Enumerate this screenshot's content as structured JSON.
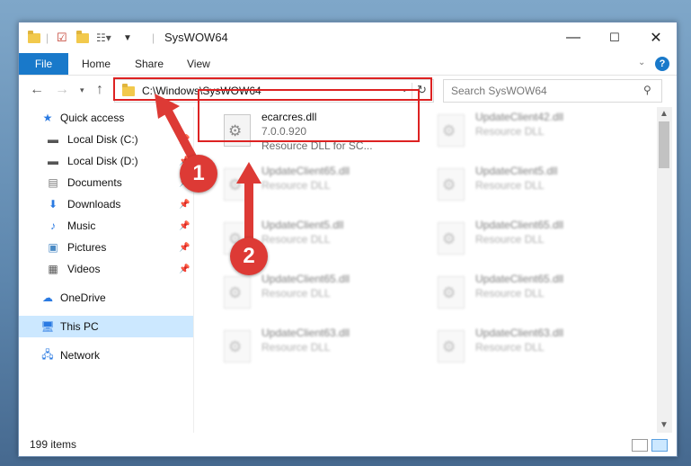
{
  "window": {
    "title": "SysWOW64",
    "controls": {
      "minimize": "—",
      "maximize": "☐",
      "close": "✕"
    }
  },
  "ribbon": {
    "file_tab": "File",
    "tabs": [
      "Home",
      "Share",
      "View"
    ],
    "help": "?"
  },
  "address_bar": {
    "path": "C:\\Windows\\SysWOW64"
  },
  "search": {
    "placeholder": "Search SysWOW64"
  },
  "sidebar": {
    "items": [
      {
        "label": "Quick access",
        "icon": "star-icon"
      },
      {
        "label": "Local Disk (C:)",
        "icon": "drive-icon",
        "pinned": true
      },
      {
        "label": "Local Disk (D:)",
        "icon": "drive-icon",
        "pinned": true
      },
      {
        "label": "Documents",
        "icon": "documents-icon",
        "pinned": true
      },
      {
        "label": "Downloads",
        "icon": "download-icon",
        "pinned": true
      },
      {
        "label": "Music",
        "icon": "music-icon",
        "pinned": true
      },
      {
        "label": "Pictures",
        "icon": "pictures-icon",
        "pinned": true
      },
      {
        "label": "Videos",
        "icon": "videos-icon",
        "pinned": true
      },
      {
        "label": "OneDrive",
        "icon": "cloud-icon"
      },
      {
        "label": "This PC",
        "icon": "pc-icon",
        "selected": true
      },
      {
        "label": "Network",
        "icon": "network-icon"
      }
    ]
  },
  "files": {
    "highlighted": {
      "name": "ecarcres.dll",
      "version": "7.0.0.920",
      "description": "Resource DLL for SC..."
    },
    "left_column": [
      {
        "name": "UpdateClient65.dll",
        "type": "Resource DLL"
      },
      {
        "name": "UpdateClient5.dll",
        "type": "Resource DLL"
      },
      {
        "name": "UpdateClient65.dll",
        "type": "Resource DLL"
      },
      {
        "name": "UpdateClient63.dll",
        "type": "Resource DLL"
      }
    ],
    "right_column": [
      {
        "name": "UpdateClient42.dll",
        "type": "Resource DLL"
      },
      {
        "name": "UpdateClient5.dll",
        "type": "Resource DLL"
      },
      {
        "name": "UpdateClient65.dll",
        "type": "Resource DLL"
      },
      {
        "name": "UpdateClient65.dll",
        "type": "Resource DLL"
      },
      {
        "name": "UpdateClient63.dll",
        "type": "Resource DLL"
      }
    ]
  },
  "status": {
    "item_count": "199 items"
  },
  "callouts": {
    "step1": "1",
    "step2": "2",
    "color": "#dd3a35"
  }
}
